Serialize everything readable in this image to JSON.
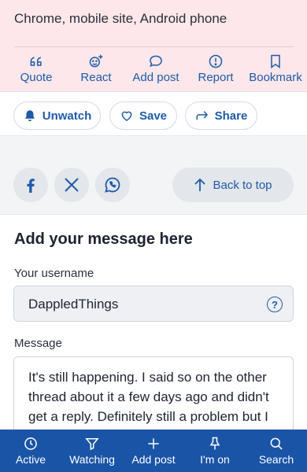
{
  "post": {
    "text": "Chrome, mobile site, Android phone",
    "actions": [
      {
        "label": "Quote",
        "icon": "quote-icon"
      },
      {
        "label": "React",
        "icon": "react-icon"
      },
      {
        "label": "Add post",
        "icon": "comment-icon"
      },
      {
        "label": "Report",
        "icon": "report-icon"
      },
      {
        "label": "Bookmark",
        "icon": "bookmark-icon"
      }
    ]
  },
  "thread_actions": {
    "unwatch": "Unwatch",
    "save": "Save",
    "share": "Share"
  },
  "share": {
    "networks": [
      "facebook-icon",
      "x-icon",
      "whatsapp-icon"
    ],
    "back_to_top": "Back to top"
  },
  "reply": {
    "title": "Add your message here",
    "username_label": "Your username",
    "username_value": "DappledThings",
    "help_mark": "?",
    "message_label": "Message",
    "message_value": "It's still happening. I said so on the other thread about it a few days ago and didn't get a reply. Definitely still a problem but I ...aning it."
  },
  "bottom_nav": [
    {
      "label": "Active",
      "icon": "clock-icon"
    },
    {
      "label": "Watching",
      "icon": "filter-icon"
    },
    {
      "label": "Add post",
      "icon": "plus-icon"
    },
    {
      "label": "I'm on",
      "icon": "pin-icon"
    },
    {
      "label": "Search",
      "icon": "search-icon"
    }
  ],
  "colors": {
    "accent": "#1e5aa8",
    "post_highlight": "#fde7ea",
    "bottom_nav": "#1a54a6"
  }
}
